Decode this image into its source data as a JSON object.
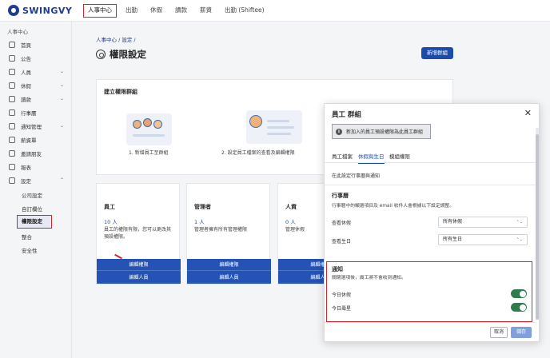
{
  "brand": {
    "name": "SWINGVY"
  },
  "nav": [
    "人事中心",
    "出勤",
    "休假",
    "讀款",
    "薪資",
    "出勤 (Shiftee)"
  ],
  "sidebar": {
    "header": "人事中心",
    "items": [
      {
        "label": "首頁",
        "icon": "home-icon"
      },
      {
        "label": "公告",
        "icon": "megaphone-icon"
      },
      {
        "label": "人員",
        "icon": "person-icon"
      },
      {
        "label": "休假",
        "icon": "calendar-icon"
      },
      {
        "label": "讀款",
        "icon": "wallet-icon"
      },
      {
        "label": "行事曆",
        "icon": "calendar-icon"
      },
      {
        "label": "通知管理",
        "icon": "gear-icon"
      },
      {
        "label": "薪資單",
        "icon": "document-icon"
      },
      {
        "label": "邀請朋友",
        "icon": "gift-icon"
      },
      {
        "label": "報表",
        "icon": "chart-icon"
      },
      {
        "label": "設定",
        "icon": "gear-icon"
      }
    ],
    "sub_items": [
      "公司設定",
      "自訂欄位",
      "權限設定",
      "整合",
      "安全性"
    ]
  },
  "breadcrumb": "人事中心  /  設定  /",
  "page_title": "權限設定",
  "new_group_button": "新增群組",
  "build_card": {
    "title": "建立權限群組",
    "steps": [
      "1. 新增員工至群組",
      "2. 設定員工檔案的查看及編輯權限"
    ]
  },
  "roles": [
    {
      "name": "員工",
      "count": "10 人",
      "desc": "員工的權限有限，您可以更改其預設權限。",
      "btn_edit": "編輯權限",
      "btn_members": "編輯人員"
    },
    {
      "name": "管理者",
      "count": "1 人",
      "desc": "管理者擁有所有管理權限",
      "btn_edit": "編輯權限",
      "btn_members": "編輯人員"
    },
    {
      "name": "人資",
      "count": "0 人",
      "desc": "管理休假",
      "btn_edit": "編輯權限",
      "btn_members": "編輯人員"
    }
  ],
  "modal": {
    "title": "員工 群組",
    "notice": "新加入的員工預設權限為此員工群組",
    "tabs": [
      "員工檔案",
      "休假與生日",
      "模組權限"
    ],
    "section_desc": "在此設定行事曆與通知",
    "calendar": {
      "title": "行事曆",
      "subtitle": "行事曆中的顯選項目及 email 收件人會根據以下設定調整。",
      "rows": [
        {
          "label": "查看休假",
          "value": "所有休假"
        },
        {
          "label": "查看生日",
          "value": "所有生日"
        }
      ]
    },
    "notify": {
      "title": "通知",
      "subtitle": "關閉選項後，員工將不會收到通知。",
      "rows": [
        {
          "label": "今日休假",
          "on": true
        },
        {
          "label": "今日壽星",
          "on": true
        }
      ]
    },
    "cancel": "取消",
    "save": "儲存"
  }
}
